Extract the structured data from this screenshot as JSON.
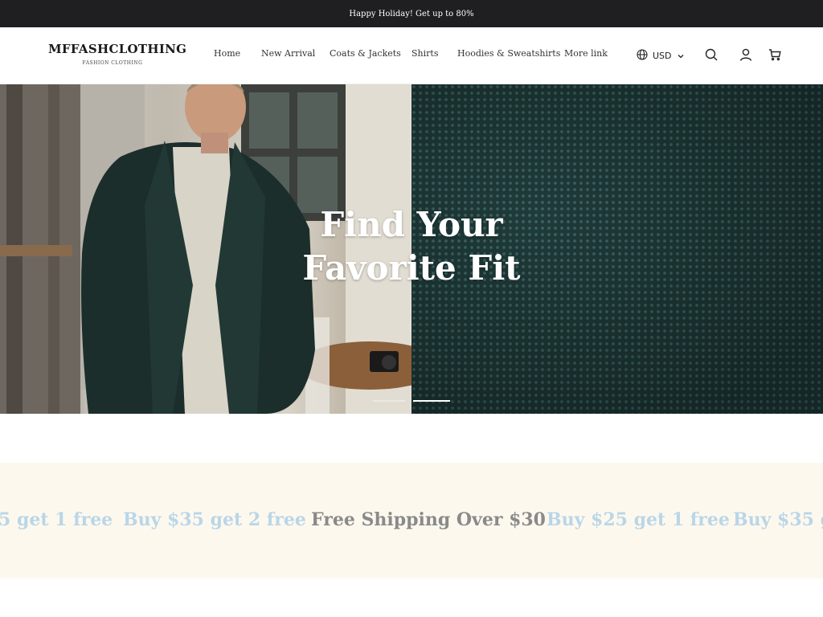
{
  "announcement": {
    "text": "Happy Holiday! Get up to 80%"
  },
  "header": {
    "brand": "MFFASHCLOTHING",
    "tagline": "FASHION CLOTHING",
    "nav": [
      "Home",
      "New Arrival",
      "Coats & Jackets",
      "Shirts",
      "Hoodies & Sweatshirts",
      "More link"
    ],
    "currency": "USD",
    "icons": [
      "globe-icon",
      "chevron-down-icon",
      "search-icon",
      "account-icon",
      "cart-icon"
    ]
  },
  "hero": {
    "title_line1": "Find Your",
    "title_line2": "Favorite Fit",
    "slides": 2,
    "active_slide": 2,
    "accent_colors": {
      "knit": "#1f3b3a",
      "cardigan": "#1b2e2b"
    }
  },
  "marquee": {
    "items": [
      "5 get 1 free",
      "Buy $35 get 2 free",
      "Free Shipping Over $30",
      "Buy $25 get 1 free",
      "Buy $35 g"
    ],
    "colors": {
      "faded": "#b9d6e8",
      "active": "#8a8a8a",
      "background": "#fdf8ee"
    }
  }
}
